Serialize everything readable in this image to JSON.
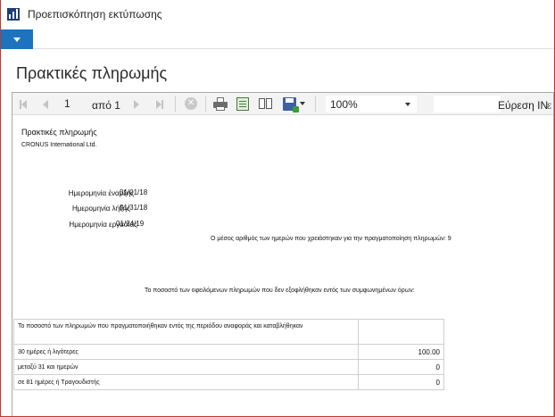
{
  "window": {
    "title": "Προεπισκόπηση εκτύπωσης",
    "icon": "chart-bars-icon"
  },
  "page": {
    "title": "Πρακτικές πληρωμής"
  },
  "toolbar": {
    "current_page": "1",
    "of_label": "από 1",
    "zoom": "100%",
    "find_label": "Εύρεση ΙΝ",
    "find_next_label": "ε"
  },
  "report": {
    "title": "Πρακτικές πληρωμής",
    "company": "CRONUS International Ltd.",
    "fields": [
      {
        "label": "Ημερομηνία έναρξης",
        "value": "01/01/18"
      },
      {
        "label": "Ημερομηνία λήξης",
        "value": "01/31/18"
      },
      {
        "label": "Ημερομηνία εργασίας",
        "value": "01/24/19"
      }
    ],
    "average_text": "Ο μέσος αριθμός των ημερών που χρειάστηκαν για την πραγματοποίηση πληρωμών: 9",
    "percentage_heading": "Το ποσοστό των οφειλόμενων πληρωμών που δεν εξοφλήθηκαν εντός των συμφωνημένων όρων:",
    "table": {
      "header": "Το ποσοστό των πληρωμών που πραγματοποιήθηκαν εντός της περιόδου αναφοράς και καταβλήθηκαν",
      "rows": [
        {
          "label": "30 ημέρες ή λιγότερες",
          "value": "100.00"
        },
        {
          "label": "μεταξύ 31 και ημερών",
          "value": "0"
        },
        {
          "label": "σε 81 ημέρες ή Τραγουδιστής",
          "value": "0"
        }
      ]
    }
  },
  "colors": {
    "accent": "#1e73be",
    "window_border": "#c0392b",
    "toolbar_bg": "#f3f3f3"
  }
}
